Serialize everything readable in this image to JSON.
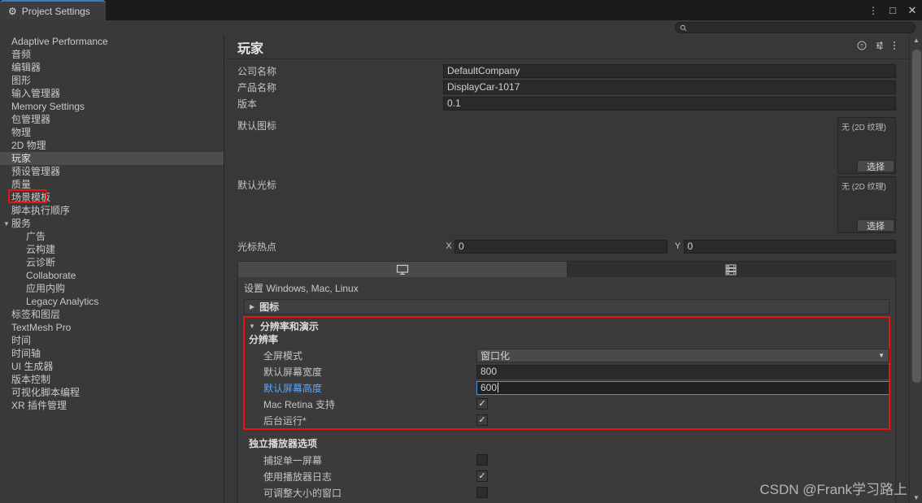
{
  "window": {
    "tab_label": "Project Settings",
    "tab_icon": "gear-icon",
    "controls": {
      "menu": "⋮",
      "maximize": "□",
      "close": "✕"
    }
  },
  "search": {
    "value": "",
    "placeholder": "",
    "icon": "search-icon"
  },
  "sidebar": {
    "items": [
      {
        "label": "Adaptive Performance",
        "level": 0,
        "selected": false,
        "expandable": false
      },
      {
        "label": "音频",
        "level": 0,
        "selected": false,
        "expandable": false
      },
      {
        "label": "编辑器",
        "level": 0,
        "selected": false,
        "expandable": false
      },
      {
        "label": "图形",
        "level": 0,
        "selected": false,
        "expandable": false
      },
      {
        "label": "输入管理器",
        "level": 0,
        "selected": false,
        "expandable": false
      },
      {
        "label": "Memory Settings",
        "level": 0,
        "selected": false,
        "expandable": false
      },
      {
        "label": "包管理器",
        "level": 0,
        "selected": false,
        "expandable": false
      },
      {
        "label": "物理",
        "level": 0,
        "selected": false,
        "expandable": false
      },
      {
        "label": "2D 物理",
        "level": 0,
        "selected": false,
        "expandable": false
      },
      {
        "label": "玩家",
        "level": 0,
        "selected": true,
        "expandable": false
      },
      {
        "label": "预设管理器",
        "level": 0,
        "selected": false,
        "expandable": false
      },
      {
        "label": "质量",
        "level": 0,
        "selected": false,
        "expandable": false
      },
      {
        "label": "场景模板",
        "level": 0,
        "selected": false,
        "expandable": false
      },
      {
        "label": "脚本执行顺序",
        "level": 0,
        "selected": false,
        "expandable": false
      },
      {
        "label": "服务",
        "level": 0,
        "selected": false,
        "expandable": true
      },
      {
        "label": "广告",
        "level": 1,
        "selected": false,
        "expandable": false
      },
      {
        "label": "云构建",
        "level": 1,
        "selected": false,
        "expandable": false
      },
      {
        "label": "云诊断",
        "level": 1,
        "selected": false,
        "expandable": false
      },
      {
        "label": "Collaborate",
        "level": 1,
        "selected": false,
        "expandable": false
      },
      {
        "label": "应用内购",
        "level": 1,
        "selected": false,
        "expandable": false
      },
      {
        "label": "Legacy Analytics",
        "level": 1,
        "selected": false,
        "expandable": false
      },
      {
        "label": "标签和图层",
        "level": 0,
        "selected": false,
        "expandable": false
      },
      {
        "label": "TextMesh Pro",
        "level": 0,
        "selected": false,
        "expandable": false
      },
      {
        "label": "时间",
        "level": 0,
        "selected": false,
        "expandable": false
      },
      {
        "label": "时间轴",
        "level": 0,
        "selected": false,
        "expandable": false
      },
      {
        "label": "UI 生成器",
        "level": 0,
        "selected": false,
        "expandable": false
      },
      {
        "label": "版本控制",
        "level": 0,
        "selected": false,
        "expandable": false
      },
      {
        "label": "可视化脚本编程",
        "level": 0,
        "selected": false,
        "expandable": false
      },
      {
        "label": "XR 插件管理",
        "level": 0,
        "selected": false,
        "expandable": false
      }
    ]
  },
  "panel": {
    "title": "玩家",
    "icons": [
      "help-icon",
      "preset-icon",
      "kebab-menu-icon"
    ]
  },
  "identity": {
    "company_label": "公司名称",
    "company_value": "DefaultCompany",
    "product_label": "产品名称",
    "product_value": "DisplayCar-1017",
    "version_label": "版本",
    "version_value": "0.1"
  },
  "default_icon": {
    "label": "默认图标",
    "texture_value": "无 (2D 纹理)",
    "select_label": "选择"
  },
  "default_cursor": {
    "label": "默认光标",
    "texture_value": "无 (2D 纹理)",
    "select_label": "选择"
  },
  "cursor_hotspot": {
    "label": "光标热点",
    "x_axis": "X",
    "x_value": "0",
    "y_axis": "Y",
    "y_value": "0"
  },
  "platform_tabs": [
    {
      "icon": "monitor-icon",
      "active": true
    },
    {
      "icon": "server-icon",
      "active": false
    }
  ],
  "platform": {
    "settings_for": "设置 Windows, Mac, Linux",
    "icon_foldout": "图标"
  },
  "resolution_section": {
    "group_title": "分辨率和演示",
    "sub_title": "分辨率",
    "highlight_color": "#ee1111",
    "rows": [
      {
        "label": "全屏模式",
        "type": "dropdown",
        "value": "窗口化",
        "highlighted": false
      },
      {
        "label": "默认屏幕宽度",
        "type": "text",
        "value": "800",
        "highlighted": false
      },
      {
        "label": "默认屏幕高度",
        "type": "text",
        "value": "600",
        "highlighted": true,
        "focused": true
      },
      {
        "label": "Mac Retina 支持",
        "type": "checkbox",
        "value": true,
        "highlighted": false
      },
      {
        "label": "后台运行*",
        "type": "checkbox",
        "value": true,
        "highlighted": false
      }
    ]
  },
  "standalone_section": {
    "title": "独立播放器选项",
    "rows": [
      {
        "label": "捕捉单一屏幕",
        "type": "checkbox",
        "value": false
      },
      {
        "label": "使用播放器日志",
        "type": "checkbox",
        "value": true
      },
      {
        "label": "可调整大小的窗口",
        "type": "checkbox",
        "value": false
      }
    ]
  },
  "watermark": {
    "text": "CSDN @Frank学习路上"
  },
  "colors": {
    "background": "#383838",
    "sidebar": "#393939",
    "titlebar": "#1b1b1b",
    "accent_blue": "#3a78c8",
    "focus_blue": "#4a90d9",
    "label_blue": "#58a6ff",
    "annotation_red": "#ee1111",
    "selection": "#4d4d4d"
  }
}
